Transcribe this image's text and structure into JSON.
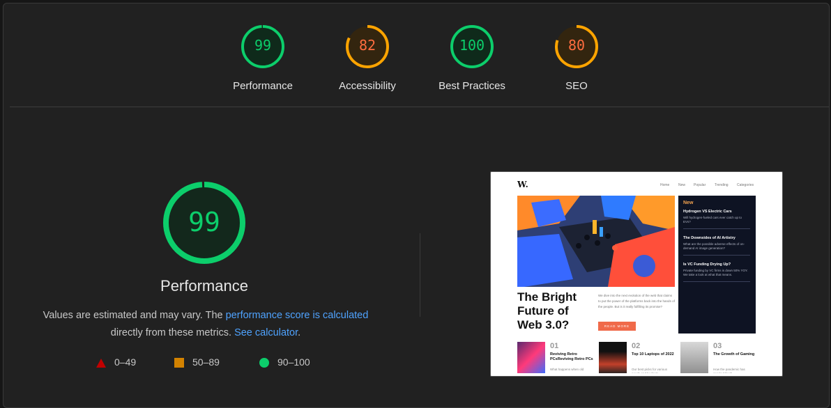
{
  "gauges": [
    {
      "score": "99",
      "label": "Performance",
      "value": 99,
      "color": "#0cce6b",
      "bg": "#0f2a1b"
    },
    {
      "score": "82",
      "label": "Accessibility",
      "value": 82,
      "color": "#ffa400",
      "bg": "#33250f",
      "text_color": "#ff6d3f"
    },
    {
      "score": "100",
      "label": "Best Practices",
      "value": 100,
      "color": "#0cce6b",
      "bg": "#0f2a1b"
    },
    {
      "score": "80",
      "label": "SEO",
      "value": 80,
      "color": "#ffa400",
      "bg": "#33250f",
      "text_color": "#ff6d3f"
    }
  ],
  "main": {
    "score": "99",
    "value": 99,
    "title": "Performance",
    "desc_pre": "Values are estimated and may vary. The ",
    "desc_link1": "performance score is calculated",
    "desc_mid": " directly from these metrics. ",
    "desc_link2": "See calculator",
    "desc_post": "."
  },
  "legend": {
    "fail": "0–49",
    "average": "50–89",
    "pass": "90–100"
  },
  "colors": {
    "pass": "#0cce6b",
    "average": "#ffa400",
    "fail": "#ff4e42",
    "link": "#4fa3ff"
  },
  "thumbnail": {
    "logo": "W.",
    "nav": [
      "Home",
      "New",
      "Popular",
      "Trending",
      "Categories"
    ],
    "hero_title": "The Bright Future of Web 3.0?",
    "hero_desc": "We dive into the next evolution of the web that claims to put the power of the platforms back into the hands of the people. But is it really fulfilling its promise?",
    "hero_button": "READ MORE",
    "new_heading": "New",
    "new_items": [
      {
        "title": "Hydrogen VS Electric Cars",
        "desc": "Will hydrogen-fueled cars ever catch up to EVs?"
      },
      {
        "title": "The Downsides of AI Artistry",
        "desc": "What are the possible adverse effects of on-demand AI image generation?"
      },
      {
        "title": "Is VC Funding Drying Up?",
        "desc": "Private funding by VC firms is down 50% YOY. We take a look at what that means."
      }
    ],
    "cards": [
      {
        "num": "01",
        "title": "Reviving Retro PCsReviving Retro PCs",
        "desc": "What happens when old"
      },
      {
        "num": "02",
        "title": "Top 10 Laptops of 2022",
        "desc": "Our best picks for various needs and budgets."
      },
      {
        "num": "03",
        "title": "The Growth of Gaming",
        "desc": "How the pandemic has sparked fresh"
      }
    ]
  }
}
